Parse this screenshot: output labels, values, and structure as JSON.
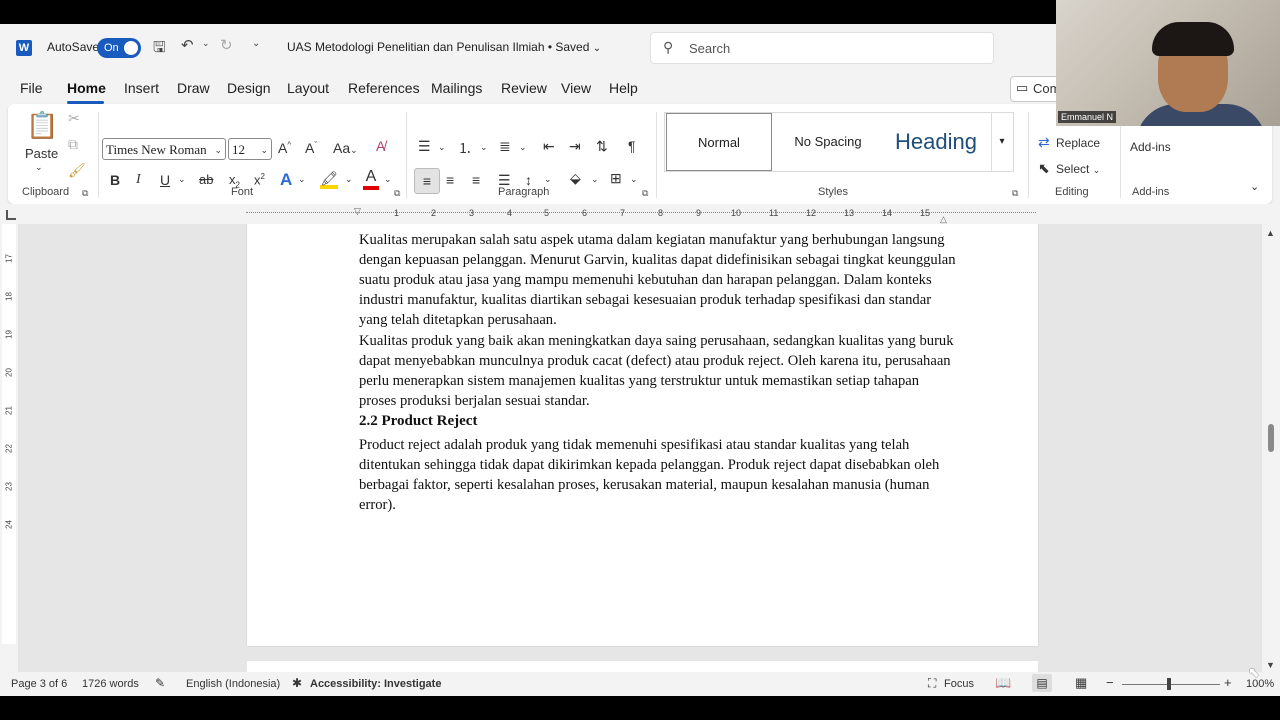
{
  "titlebar": {
    "app_icon": "word-icon",
    "autosave_label": "AutoSave",
    "autosave_state": "On",
    "document_title": "UAS Metodologi Penelitian dan Penulisan Ilmiah • Saved",
    "search_placeholder": "Search"
  },
  "tabs": [
    "File",
    "Home",
    "Insert",
    "Draw",
    "Design",
    "Layout",
    "References",
    "Mailings",
    "Review",
    "View",
    "Help"
  ],
  "active_tab": "Home",
  "comments_label": "Com",
  "ribbon": {
    "clipboard": {
      "paste": "Paste",
      "label": "Clipboard"
    },
    "font": {
      "family": "Times New Roman",
      "size": "12",
      "label": "Font",
      "increase": "A^",
      "decrease": "Aˇ",
      "change_case": "Aa"
    },
    "paragraph": {
      "label": "Paragraph"
    },
    "styles": {
      "label": "Styles",
      "items": [
        "Normal",
        "No Spacing",
        "Heading"
      ]
    },
    "editing": {
      "label": "Editing",
      "replace": "Replace",
      "select": "Select"
    },
    "addins": {
      "label": "Add-ins",
      "button": "Add-ins"
    }
  },
  "ruler": {
    "h_numbers": [
      "1",
      "2",
      "3",
      "4",
      "5",
      "6",
      "7",
      "8",
      "9",
      "10",
      "11",
      "12",
      "13",
      "14",
      "15"
    ],
    "v_numbers": [
      "17",
      "18",
      "19",
      "20",
      "21",
      "22",
      "23",
      "24"
    ]
  },
  "document": {
    "paragraph1": "Kualitas merupakan salah satu aspek utama dalam kegiatan manufaktur yang berhubungan langsung dengan kepuasan pelanggan. Menurut Garvin, kualitas dapat didefinisikan sebagai tingkat keunggulan suatu produk atau jasa yang mampu memenuhi kebutuhan dan harapan pelanggan. Dalam konteks industri manufaktur, kualitas diartikan sebagai kesesuaian produk terhadap spesifikasi dan standar yang telah ditetapkan perusahaan.",
    "paragraph2": "Kualitas produk yang baik akan meningkatkan daya saing perusahaan, sedangkan kualitas yang buruk dapat menyebabkan munculnya produk cacat (defect) atau produk reject. Oleh karena itu, perusahaan perlu menerapkan sistem manajemen kualitas yang terstruktur untuk memastikan setiap tahapan proses produksi berjalan sesuai standar.",
    "heading": "2.2 Product Reject",
    "paragraph3": "Product reject adalah produk yang tidak memenuhi spesifikasi atau standar kualitas yang telah ditentukan sehingga tidak dapat dikirimkan kepada pelanggan. Produk reject dapat disebabkan oleh berbagai faktor, seperti kesalahan proses, kerusakan material, maupun kesalahan manusia (human error)."
  },
  "statusbar": {
    "page": "Page 3 of 6",
    "words": "1726 words",
    "language": "English (Indonesia)",
    "accessibility": "Accessibility: Investigate",
    "focus": "Focus",
    "zoom": "100%"
  },
  "webcam": {
    "name": "Emmanuel N"
  },
  "colors": {
    "accent": "#185abd",
    "highlight": "#ffd400",
    "font_color": "#e00000",
    "spell_underline": "#d24726"
  }
}
